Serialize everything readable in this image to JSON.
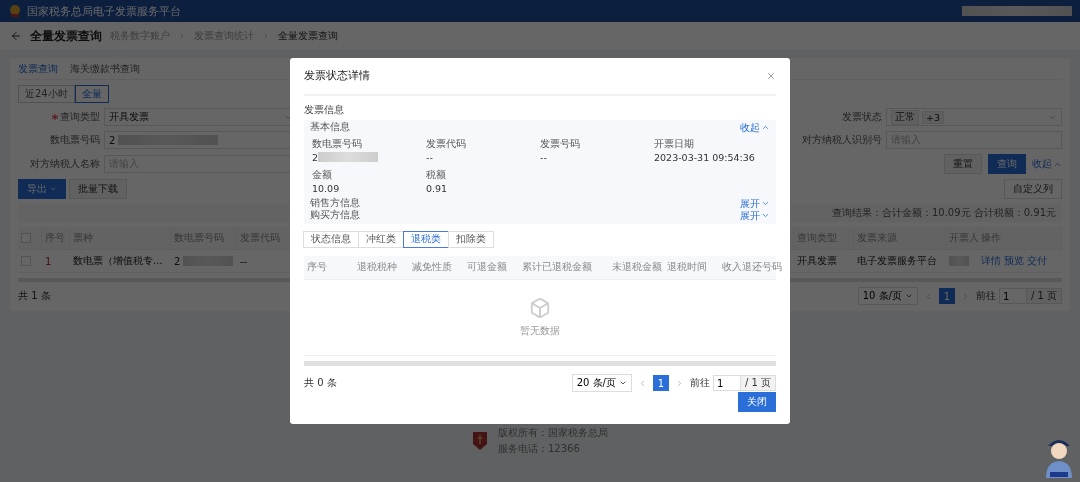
{
  "header": {
    "title": "国家税务总局电子发票服务平台"
  },
  "page": {
    "title": "全量发票查询",
    "breadcrumb": [
      "税务数字账户",
      "发票查询统计",
      "全量发票查询"
    ]
  },
  "query_tabs": [
    {
      "label": "发票查询",
      "selected": true
    },
    {
      "label": "海关缴款书查询",
      "selected": false
    }
  ],
  "range_toggle": [
    {
      "label": "近24小时",
      "selected": false
    },
    {
      "label": "全量",
      "selected": true
    }
  ],
  "filters": {
    "left": [
      {
        "label": "查询类型",
        "required": true,
        "kind": "select",
        "value": "开具发票"
      },
      {
        "label": "数电票号码",
        "required": false,
        "kind": "redacted",
        "value": "2"
      },
      {
        "label": "对方纳税人名称",
        "required": false,
        "kind": "input",
        "placeholder": "请输入"
      }
    ],
    "right": [
      {
        "label": "发票状态",
        "required": false,
        "kind": "tags",
        "tags": [
          "正常",
          "+3"
        ]
      },
      {
        "label": "对方纳税人识别号",
        "required": false,
        "kind": "input",
        "placeholder": "请输入"
      }
    ]
  },
  "filter_actions": {
    "reset": "重置",
    "search": "查询",
    "collapse": "收起"
  },
  "toolbar": {
    "export": "导出",
    "batch_download": "批量下载",
    "custom_columns": "自定义列"
  },
  "summary": "查询结果：合计金额：10.09元  合计税额：0.91元",
  "table": {
    "all_checked": false,
    "columns": [
      "序号",
      "票种",
      "数电票号码",
      "发票代码",
      "查询类型",
      "发票来源",
      "开票人",
      "操作"
    ],
    "rows": [
      {
        "checked": false,
        "index": "1",
        "type": "数电票（增值税专...",
        "number": "2",
        "code": "--",
        "query_type": "开具发票",
        "source": "电子发票服务平台",
        "actions": [
          "详情",
          "预览",
          "交付"
        ]
      }
    ]
  },
  "pagination": {
    "total": "共 1 条",
    "page_size": "10 条/页",
    "pages": [
      {
        "label": "1",
        "selected": true
      }
    ],
    "goto_label": "前往",
    "goto_value": "1",
    "page_count": "/ 1 页"
  },
  "footer": {
    "lines": [
      "版权所有：国家税务总局",
      "服务电话：12366"
    ]
  },
  "modal": {
    "title": "发票状态详情",
    "section_title": "发票信息",
    "groups": [
      {
        "title": "基本信息",
        "expanded": true,
        "toggle": "收起",
        "fields": [
          {
            "label": "数电票号码",
            "value": "2",
            "redacted": true
          },
          {
            "label": "发票代码",
            "value": "--",
            "redacted": false
          },
          {
            "label": "发票号码",
            "value": "--",
            "redacted": false
          },
          {
            "label": "开票日期",
            "value": "2023-03-31 09:54:36",
            "redacted": false
          },
          {
            "label": "金额",
            "value": "10.09",
            "redacted": false
          },
          {
            "label": "税额",
            "value": "0.91",
            "redacted": false
          }
        ]
      },
      {
        "title": "销售方信息",
        "expanded": false,
        "toggle": "展开"
      },
      {
        "title": "购买方信息",
        "expanded": false,
        "toggle": "展开"
      }
    ],
    "tabs": [
      {
        "label": "状态信息",
        "selected": false
      },
      {
        "label": "冲红类",
        "selected": false
      },
      {
        "label": "退税类",
        "selected": true
      },
      {
        "label": "扣除类",
        "selected": false
      }
    ],
    "table": {
      "columns": [
        "序号",
        "退税税种",
        "减免性质",
        "可退金额",
        "累计已退税金额",
        "未退税金额",
        "退税时间",
        "收入退还号码"
      ],
      "empty_text": "暂无数据"
    },
    "pagination": {
      "total": "共 0 条",
      "page_size": "20 条/页",
      "pages": [
        {
          "label": "1",
          "selected": true
        }
      ],
      "goto_label": "前往",
      "goto_value": "1",
      "page_count": "/ 1 页"
    },
    "close_button": "关闭"
  }
}
